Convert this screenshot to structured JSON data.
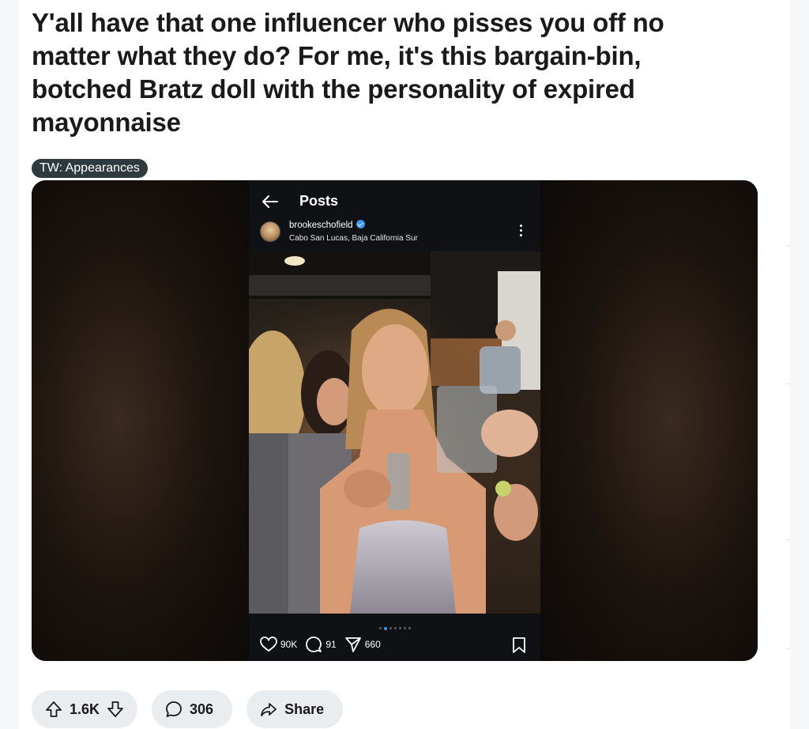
{
  "post": {
    "title": "Y'all have that one influencer who pisses you off no matter what they do? For me, it's this bargain-bin, botched Bratz doll with the personality of expired mayonnaise",
    "flair": "TW: Appearances"
  },
  "embedded_screenshot": {
    "header_title": "Posts",
    "username": "brookeschofield",
    "location": "Cabo San Lucas, Baja California Sur",
    "likes": "90K",
    "comments": "91",
    "shares": "660",
    "carousel_dots": 7,
    "active_dot": 1
  },
  "actions": {
    "score": "1.6K",
    "comments": "306",
    "share_label": "Share"
  },
  "icons": {
    "upvote": "arrow-up-icon",
    "downvote": "arrow-down-icon",
    "comment": "speech-bubble-icon",
    "share": "share-arrow-icon",
    "back": "back-arrow-icon",
    "heart": "heart-icon",
    "ig_comment": "comment-icon",
    "send": "send-icon",
    "bookmark": "bookmark-icon",
    "more": "more-vertical-icon",
    "verified": "verified-badge-icon"
  },
  "colors": {
    "flair_bg": "#2f3a3e",
    "pill_bg": "#eaedef",
    "verified_blue": "#3897f0",
    "ig_bg": "#0f1115"
  }
}
